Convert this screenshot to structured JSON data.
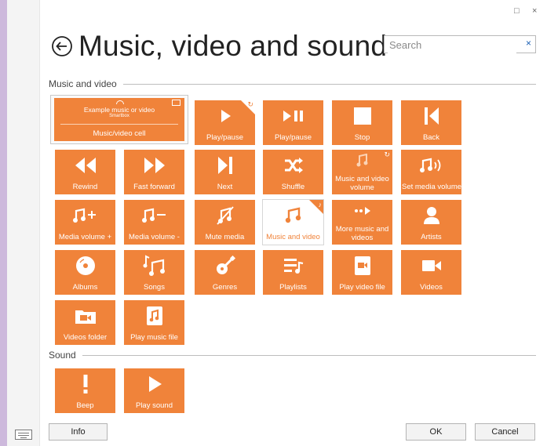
{
  "window": {
    "minimize_glyph": "□",
    "close_glyph": "×"
  },
  "header": {
    "title": "Music, video and sound",
    "back_icon": "back-arrow-circle-icon"
  },
  "search": {
    "placeholder": "Search",
    "clear_glyph": "×"
  },
  "sections": {
    "music_video": "Music and video",
    "sound": "Sound"
  },
  "cell": {
    "example_text": "Example music or video",
    "app_name": "Smartbox",
    "label": "Music/video cell"
  },
  "tiles": {
    "play_pause_1": "Play/pause",
    "play_pause_2": "Play/pause",
    "stop": "Stop",
    "back": "Back",
    "rewind": "Rewind",
    "fast_forward": "Fast forward",
    "next": "Next",
    "shuffle": "Shuffle",
    "mv_volume": "Music and video volume",
    "set_media_volume": "Set media volume",
    "media_volume_up": "Media volume +",
    "media_volume_down": "Media volume -",
    "mute_media": "Mute media",
    "music_and_video": "Music and video",
    "more_music_videos": "More music and videos",
    "artists": "Artists",
    "albums": "Albums",
    "songs": "Songs",
    "genres": "Genres",
    "playlists": "Playlists",
    "play_video_file": "Play video file",
    "videos": "Videos",
    "videos_folder": "Videos folder",
    "play_music_file": "Play music file",
    "beep": "Beep",
    "play_sound": "Play sound"
  },
  "footer": {
    "info": "Info",
    "ok": "OK",
    "cancel": "Cancel"
  },
  "colors": {
    "accent": "#f0833a",
    "background": "#cdb9dc"
  }
}
